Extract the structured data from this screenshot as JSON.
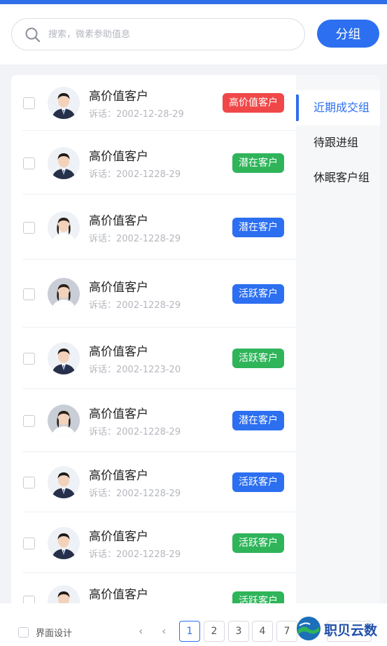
{
  "search": {
    "placeholder": "搜索，微素参助值息"
  },
  "header": {
    "group_button": "分组"
  },
  "rows": [
    {
      "name": "高价值客户",
      "sub": "诉话：2002-12-28-29",
      "tag": "高价值客户",
      "tag_color": "#f04848"
    },
    {
      "name": "高价值客户",
      "sub": "诉话：2002-1228-29",
      "tag": "潜在客户",
      "tag_color": "#2fb45a"
    },
    {
      "name": "高价值客户",
      "sub": "诉话：2002-1228-29",
      "tag": "潜在客户",
      "tag_color": "#2c6ff0"
    },
    {
      "name": "高价值客户",
      "sub": "诉话：2002-1228-29",
      "tag": "活跃客户",
      "tag_color": "#2c6ff0"
    },
    {
      "name": "高价值客户",
      "sub": "诉话：2002-1223-20",
      "tag": "活跃客户",
      "tag_color": "#2fb45a"
    },
    {
      "name": "高价值客户",
      "sub": "诉话：2002-1228-29",
      "tag": "潜在客户",
      "tag_color": "#2c6ff0"
    },
    {
      "name": "高价值客户",
      "sub": "诉话：2002-1228-29",
      "tag": "活跃客户",
      "tag_color": "#2c6ff0"
    },
    {
      "name": "高价值客户",
      "sub": "诉话：2002-1228-29",
      "tag": "活跃客户",
      "tag_color": "#2fb45a"
    },
    {
      "name": "高价值客户",
      "sub": "",
      "tag": "活跃客户",
      "tag_color": "#2fb45a"
    }
  ],
  "sidebar": {
    "items": [
      {
        "label": "近期成交组",
        "active": true
      },
      {
        "label": "待跟进组",
        "active": false
      },
      {
        "label": "休眠客户组",
        "active": false
      }
    ]
  },
  "footer": {
    "select_label": "界面设计",
    "pages": [
      "1",
      "2",
      "3",
      "4",
      "7"
    ],
    "current_page": "1",
    "watermark": "职贝云数"
  },
  "colors": {
    "accent": "#2c6ff0",
    "red": "#f04848",
    "green": "#2fb45a"
  }
}
